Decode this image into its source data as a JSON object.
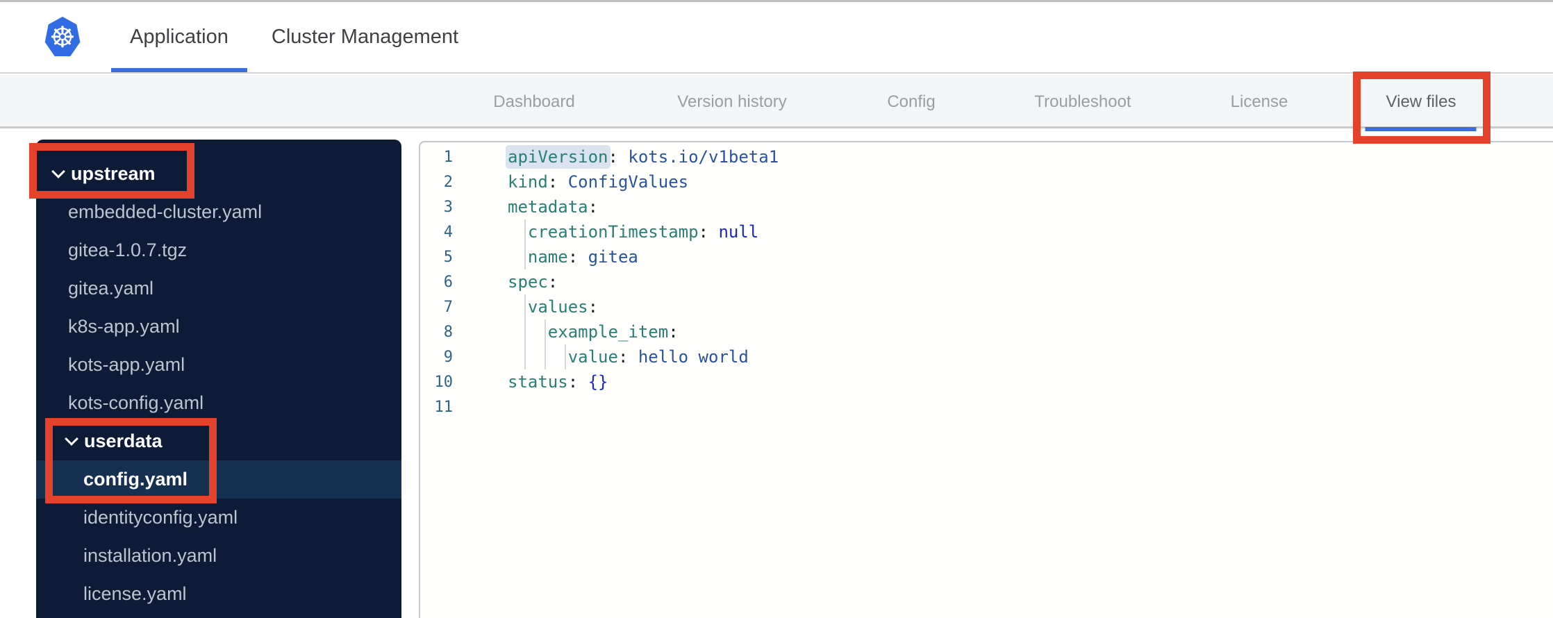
{
  "theme": {
    "accent_blue": "#3d6cdb",
    "logo_blue": "#326ce5",
    "annotation_red": "#e5422b",
    "sidebar_bg": "#0d1b36",
    "sidebar_highlight": "#163052",
    "code_key_color": "#287f74",
    "code_value_color": "#2a52a2",
    "code_keyword_color": "#1d24cc",
    "line_number_color": "#2f6486"
  },
  "icons": {
    "kubernetes_logo_glyph": "☸",
    "folder_expand_glyph": "chevron-down"
  },
  "header": {
    "tabs": [
      {
        "label": "Application",
        "active": true
      },
      {
        "label": "Cluster Management",
        "active": false
      }
    ]
  },
  "subnav": {
    "tabs": [
      {
        "label": "Dashboard",
        "active": false,
        "annotated": false
      },
      {
        "label": "Version history",
        "active": false,
        "annotated": false
      },
      {
        "label": "Config",
        "active": false,
        "annotated": false
      },
      {
        "label": "Troubleshoot",
        "active": false,
        "annotated": false
      },
      {
        "label": "License",
        "active": false,
        "annotated": false
      },
      {
        "label": "View files",
        "active": true,
        "annotated": true
      }
    ]
  },
  "file_tree": {
    "items": [
      {
        "label": "upstream",
        "type": "folder",
        "level": 0,
        "expanded": true,
        "selected": false,
        "annotated": true
      },
      {
        "label": "embedded-cluster.yaml",
        "type": "file",
        "level": 1,
        "selected": false
      },
      {
        "label": "gitea-1.0.7.tgz",
        "type": "file",
        "level": 1,
        "selected": false
      },
      {
        "label": "gitea.yaml",
        "type": "file",
        "level": 1,
        "selected": false
      },
      {
        "label": "k8s-app.yaml",
        "type": "file",
        "level": 1,
        "selected": false
      },
      {
        "label": "kots-app.yaml",
        "type": "file",
        "level": 1,
        "selected": false
      },
      {
        "label": "kots-config.yaml",
        "type": "file",
        "level": 1,
        "selected": false
      },
      {
        "label": "userdata",
        "type": "folder",
        "level": 1,
        "expanded": true,
        "selected": false,
        "annotated": true
      },
      {
        "label": "config.yaml",
        "type": "file",
        "level": 2,
        "selected": true,
        "annotated": true
      },
      {
        "label": "identityconfig.yaml",
        "type": "file",
        "level": 2,
        "selected": false
      },
      {
        "label": "installation.yaml",
        "type": "file",
        "level": 2,
        "selected": false
      },
      {
        "label": "license.yaml",
        "type": "file",
        "level": 2,
        "selected": false
      }
    ]
  },
  "editor": {
    "language": "yaml",
    "lines": [
      {
        "n": 1,
        "indent": 0,
        "tokens": [
          {
            "t": "key",
            "v": "apiVersion",
            "hl": true
          },
          {
            "t": "pl",
            "v": ":"
          },
          {
            "t": "pl",
            "v": " "
          },
          {
            "t": "val",
            "v": "kots.io/v1beta1"
          }
        ]
      },
      {
        "n": 2,
        "indent": 0,
        "tokens": [
          {
            "t": "key",
            "v": "kind"
          },
          {
            "t": "pl",
            "v": ": "
          },
          {
            "t": "val",
            "v": "ConfigValues"
          }
        ]
      },
      {
        "n": 3,
        "indent": 0,
        "tokens": [
          {
            "t": "key",
            "v": "metadata"
          },
          {
            "t": "pl",
            "v": ":"
          }
        ]
      },
      {
        "n": 4,
        "indent": 2,
        "tokens": [
          {
            "t": "key",
            "v": "creationTimestamp"
          },
          {
            "t": "pl",
            "v": ": "
          },
          {
            "t": "kw",
            "v": "null"
          }
        ]
      },
      {
        "n": 5,
        "indent": 2,
        "tokens": [
          {
            "t": "key",
            "v": "name"
          },
          {
            "t": "pl",
            "v": ": "
          },
          {
            "t": "val",
            "v": "gitea"
          }
        ]
      },
      {
        "n": 6,
        "indent": 0,
        "tokens": [
          {
            "t": "key",
            "v": "spec"
          },
          {
            "t": "pl",
            "v": ":"
          }
        ]
      },
      {
        "n": 7,
        "indent": 2,
        "tokens": [
          {
            "t": "key",
            "v": "values"
          },
          {
            "t": "pl",
            "v": ":"
          }
        ]
      },
      {
        "n": 8,
        "indent": 4,
        "tokens": [
          {
            "t": "key",
            "v": "example_item"
          },
          {
            "t": "pl",
            "v": ":"
          }
        ]
      },
      {
        "n": 9,
        "indent": 6,
        "tokens": [
          {
            "t": "key",
            "v": "value"
          },
          {
            "t": "pl",
            "v": ": "
          },
          {
            "t": "val",
            "v": "hello world"
          }
        ]
      },
      {
        "n": 10,
        "indent": 0,
        "tokens": [
          {
            "t": "key",
            "v": "status"
          },
          {
            "t": "pl",
            "v": ": "
          },
          {
            "t": "kw",
            "v": "{}"
          }
        ]
      },
      {
        "n": 11,
        "indent": 0,
        "tokens": []
      }
    ],
    "indent_guides": [
      {
        "level": 1,
        "from_line": 4,
        "to_line": 5
      },
      {
        "level": 1,
        "from_line": 7,
        "to_line": 9
      },
      {
        "level": 2,
        "from_line": 8,
        "to_line": 9
      },
      {
        "level": 3,
        "from_line": 9,
        "to_line": 9
      }
    ]
  },
  "annotations": {
    "note": "red highlight boxes drawn on screenshot",
    "targets": [
      "upstream folder row",
      "userdata folder + config.yaml rows",
      "View files tab"
    ]
  }
}
